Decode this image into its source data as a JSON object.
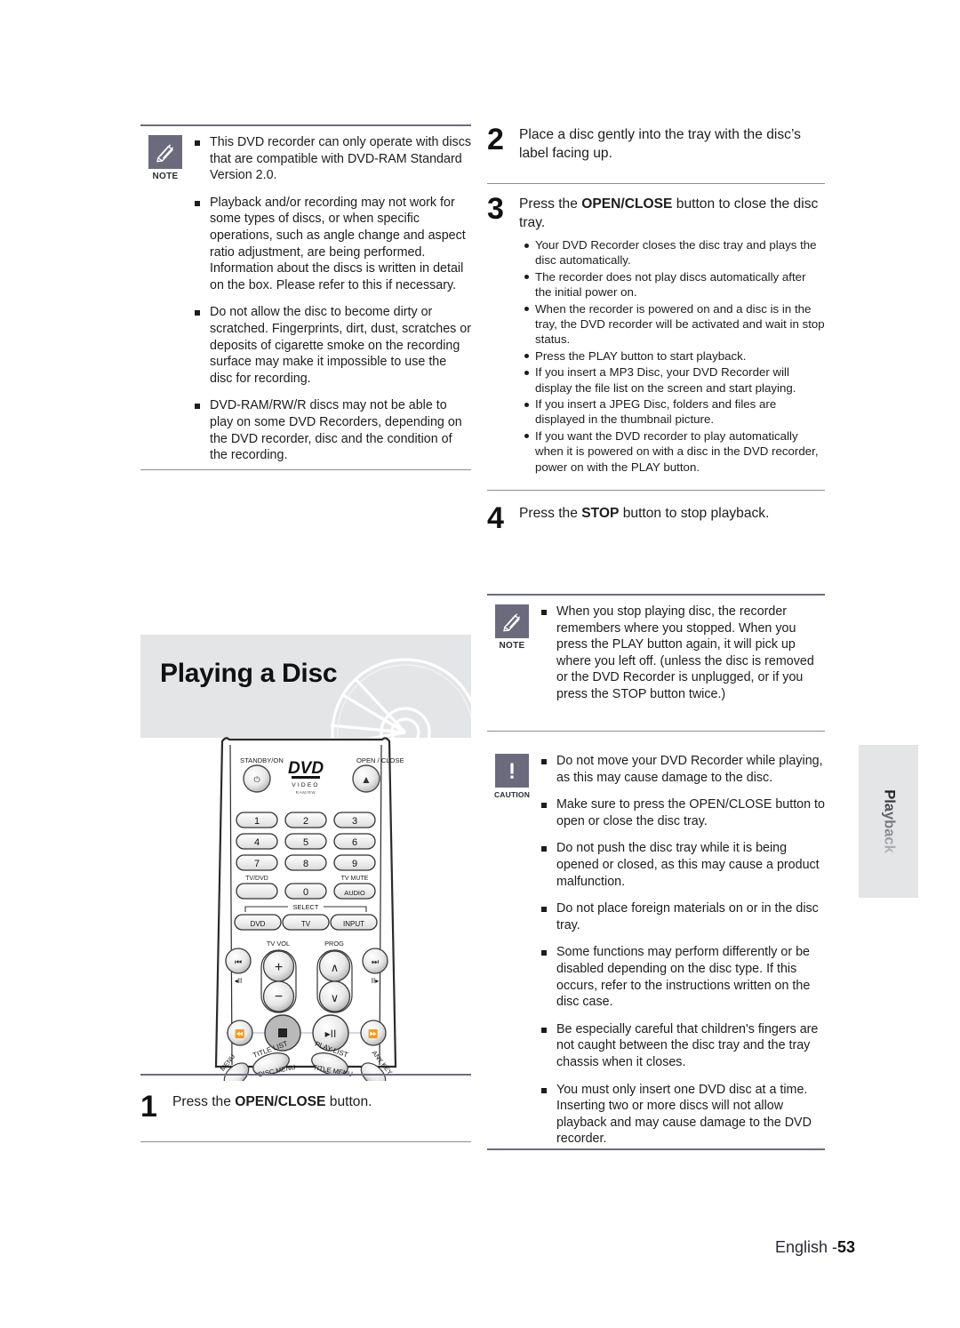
{
  "page": {
    "footer_language": "English -",
    "footer_number": "53",
    "side_tab": "Playback"
  },
  "left_column": {
    "note": {
      "icon": "pencil-icon",
      "label": "NOTE",
      "bullets": [
        "This DVD recorder can only operate with discs that are compatible with DVD-RAM Standard Version 2.0.",
        "Playback and/or recording may not work for some types of discs, or when specific operations, such as angle change and aspect ratio adjustment, are being performed. Information about the discs is written in detail on the box. Please refer to this if necessary.",
        "Do not allow the disc to become dirty or scratched. Fingerprints, dirt, dust, scratches or deposits of cigarette smoke on the recording surface may make it impossible to use the disc for recording.",
        "DVD-RAM/RW/R discs may not be able to play on some DVD Recorders, depending on the DVD recorder, disc and the condition of the recording."
      ]
    },
    "section_title": "Playing a Disc",
    "remote": {
      "standby_label": "STANDBY/ON",
      "standby_glyph": "⏻",
      "logo_main": "DVD",
      "logo_sub": "V I D E O",
      "logo_tiny": "RAM/RW",
      "open_close_label": "OPEN / CLOSE",
      "open_close_glyph": "▲",
      "numbers": [
        "1",
        "2",
        "3",
        "4",
        "5",
        "6",
        "7",
        "8",
        "9"
      ],
      "tvdvd_label": "TV/DVD",
      "tvmute_label": "TV MUTE",
      "zero": "0",
      "audio": "AUDIO",
      "select_label": "SELECT",
      "select_buttons": [
        "DVD",
        "TV",
        "INPUT"
      ],
      "tvvol_label": "TV VOL",
      "prog_label": "PROG",
      "vol_plus": "+",
      "vol_minus": "−",
      "prog_up": "∧",
      "prog_down": "∨",
      "skip_back": "⏮",
      "skip_fwd": "⏭",
      "step_back": "◂II",
      "step_fwd": "II▸",
      "rew": "◂◂",
      "stop": "■",
      "playpause": "▸II",
      "ff": "▸▸",
      "title_list": "TITLE LIST",
      "play_list": "PLAY LIST",
      "menu": "MENU",
      "disc_menu": "DISC MENU",
      "title_menu": "TITLE MENU",
      "any_key": "ANY KEY"
    },
    "step1": {
      "number": "1",
      "text_before": "Press the ",
      "text_bold": "OPEN/CLOSE",
      "text_after": " button."
    }
  },
  "right_column": {
    "step2": {
      "number": "2",
      "text": "Place a disc gently into the tray with the disc’s label facing up."
    },
    "step3": {
      "number": "3",
      "text_before": "Press the ",
      "text_bold": "OPEN/CLOSE",
      "text_after": " button to close the disc tray.",
      "bullets": [
        "Your DVD Recorder closes the disc tray and plays the disc automatically.",
        "The recorder does not play discs automatically after the initial power on.",
        "When the recorder is powered on and a disc is in the tray, the DVD recorder will be activated and wait in stop status.",
        "Press the PLAY button to start playback.",
        "If you insert a MP3 Disc, your DVD Recorder will display the file list on the screen and start playing.",
        "If you insert a JPEG Disc, folders and files are displayed in the thumbnail picture.",
        "If you want the DVD recorder to play automatically when it is powered on with a disc in the DVD recorder, power on with the PLAY button."
      ]
    },
    "step4": {
      "number": "4",
      "text_before": "Press the ",
      "text_bold": "STOP",
      "text_after": " button to stop playback."
    },
    "note": {
      "icon": "pencil-icon",
      "label": "NOTE",
      "bullets": [
        "When you stop playing disc, the recorder remembers where you stopped. When you press the PLAY button again, it will pick up where you left off. (unless the disc is removed or the DVD Recorder is unplugged, or if you press the STOP button twice.)"
      ]
    },
    "caution": {
      "icon": "exclamation-icon",
      "label": "CAUTION",
      "bullets": [
        "Do not move your DVD Recorder while playing, as this may cause damage to the disc.",
        "Make sure to press the OPEN/CLOSE button to open or close the disc tray.",
        "Do not push the disc tray while it is being opened or closed, as this may cause a product malfunction.",
        "Do not place foreign materials on or in the disc tray.",
        "Some functions may perform differently or be disabled depending on the disc type. If this occurs, refer to the instructions written on the disc case.",
        "Be especially careful that children's fingers are not caught between the disc tray and the tray chassis when it closes.",
        "You must only insert one DVD disc at a time. Inserting two or more discs will not allow playback and may cause damage to the DVD recorder."
      ]
    }
  }
}
